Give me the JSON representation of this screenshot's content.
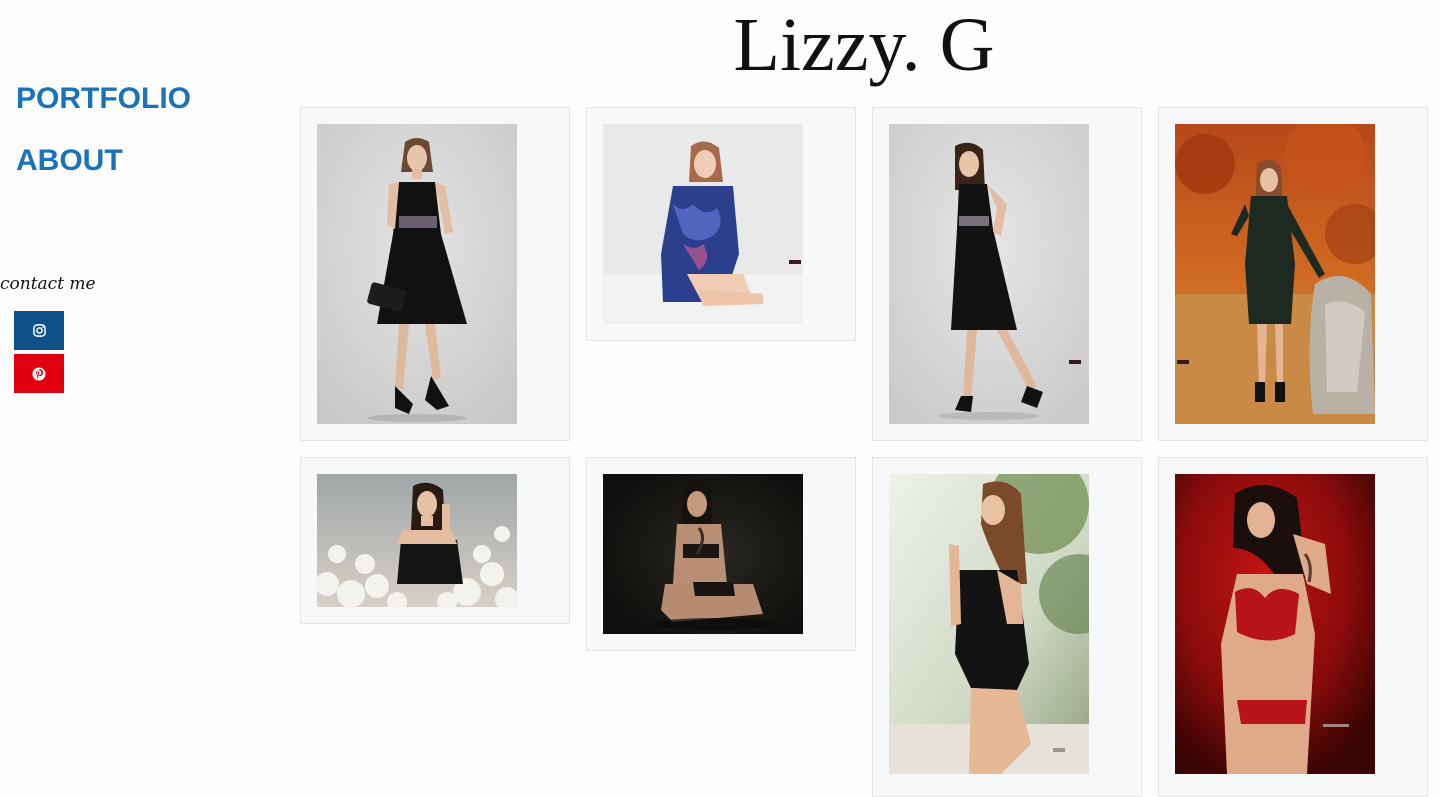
{
  "site": {
    "title": "Lizzy. G"
  },
  "nav": {
    "items": [
      {
        "label": "PORTFOLIO"
      },
      {
        "label": "ABOUT"
      }
    ]
  },
  "contact": {
    "title": "contact me",
    "links": [
      {
        "icon": "instagram-icon",
        "color": "#0d5188"
      },
      {
        "icon": "pinterest-icon",
        "color": "#e00010"
      }
    ]
  },
  "colors": {
    "nav_link": "#1a73b8",
    "card_background": "#f7f8fa",
    "card_border": "#e2e4e8"
  },
  "gallery": {
    "photos": [
      {
        "subject": "woman in black dress on light grey backdrop"
      },
      {
        "subject": "woman in blue floral robe sitting on white floor"
      },
      {
        "subject": "woman in black dress posing on light grey backdrop"
      },
      {
        "subject": "woman in dark green coat in autumn forest"
      },
      {
        "subject": "woman among white cotton flowers"
      },
      {
        "subject": "tattooed woman kneeling on dark background"
      },
      {
        "subject": "woman in black bodysuit outdoors"
      },
      {
        "subject": "woman in red lingerie on red background"
      }
    ]
  }
}
